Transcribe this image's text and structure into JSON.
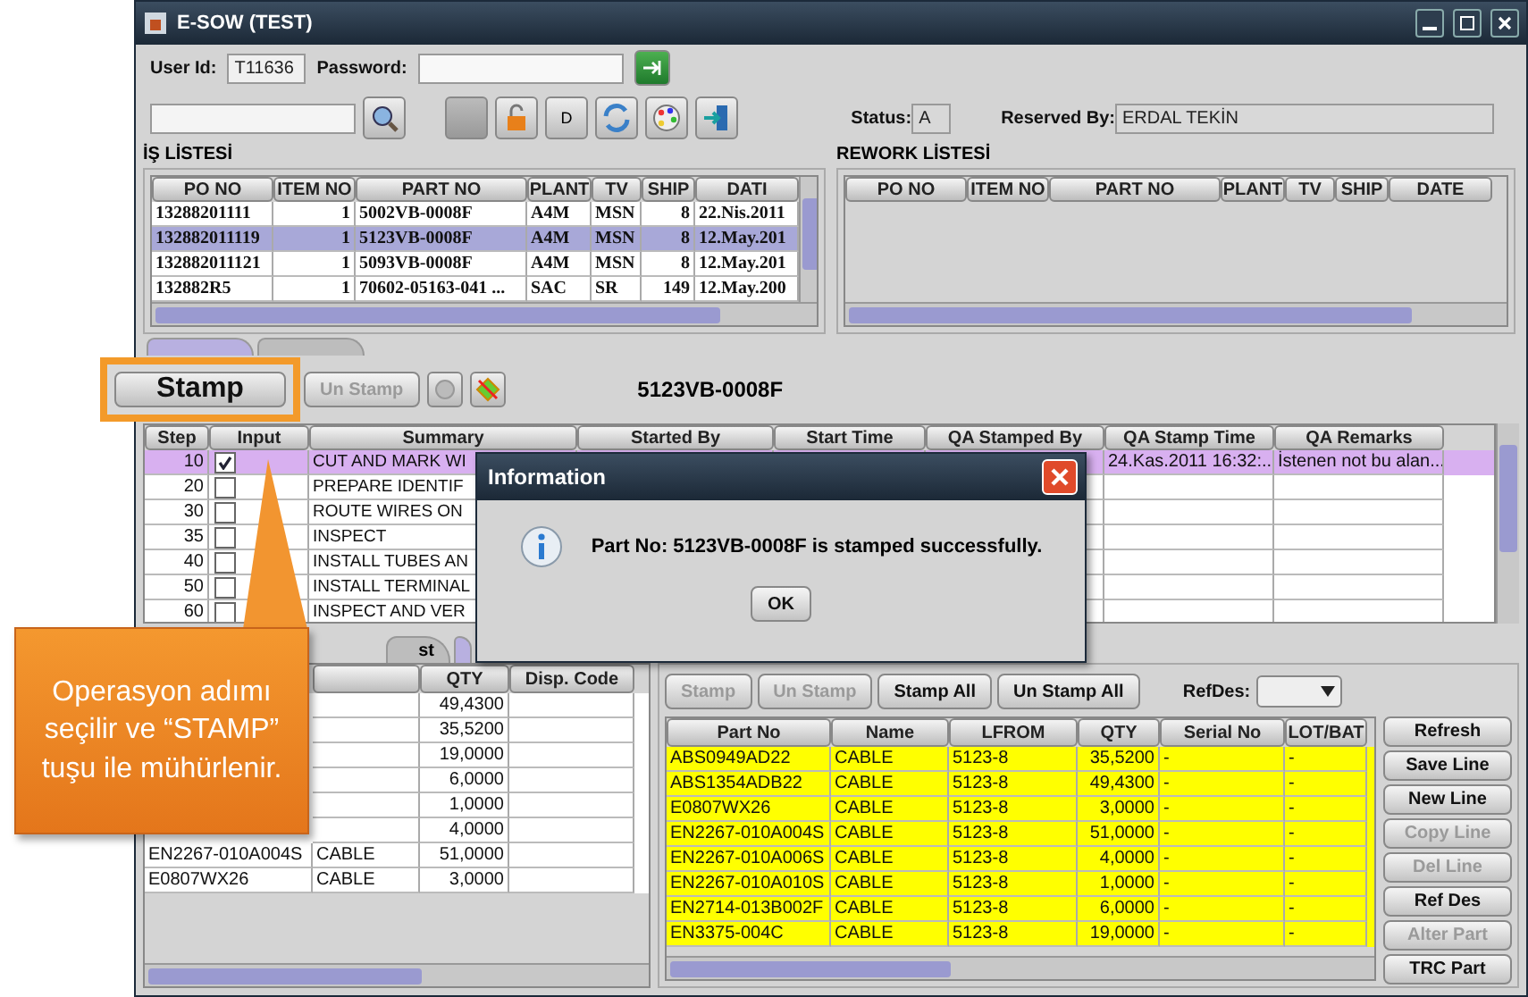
{
  "window": {
    "title": "E-SOW (TEST)"
  },
  "login": {
    "user_id_label": "User Id:",
    "user_id": "T11636",
    "password_label": "Password:"
  },
  "toolbar": {
    "d_button": "D",
    "status_label": "Status:",
    "status": "A",
    "reserved_label": "Reserved By:",
    "reserved_by": "ERDAL TEKİN"
  },
  "work_list": {
    "title": "İŞ LİSTESİ",
    "columns": [
      "PO NO",
      "ITEM NO",
      "PART NO",
      "PLANT",
      "TV",
      "SHIP",
      "DATI"
    ],
    "rows": [
      {
        "cells": [
          "13288201111",
          "1",
          "5002VB-0008F",
          "A4M",
          "MSN",
          "8",
          "22.Nis.2011"
        ],
        "selected": false
      },
      {
        "cells": [
          "132882011119",
          "1",
          "5123VB-0008F",
          "A4M",
          "MSN",
          "8",
          "12.May.201"
        ],
        "selected": true
      },
      {
        "cells": [
          "132882011121",
          "1",
          "5093VB-0008F",
          "A4M",
          "MSN",
          "8",
          "12.May.201"
        ],
        "selected": false
      },
      {
        "cells": [
          "132882R5",
          "1",
          "70602-05163-041     ...",
          "SAC",
          "SR",
          "149",
          "12.May.200"
        ],
        "selected": false
      }
    ]
  },
  "rework_list": {
    "title": "REWORK LİSTESİ",
    "columns": [
      "PO NO",
      "ITEM NO",
      "PART NO",
      "PLANT",
      "TV",
      "SHIP",
      "DATE"
    ]
  },
  "main_tabs": [
    {
      "selected": true
    },
    {
      "selected": false
    }
  ],
  "stamp_bar": {
    "unstamp": "Un Stamp",
    "part_no": "5123VB-0008F"
  },
  "steps": {
    "columns": [
      "Step",
      "Input",
      "Summary",
      "Started By",
      "Start Time",
      "QA Stamped By",
      "QA Stamp Time",
      "QA Remarks"
    ],
    "rows": [
      {
        "step": "10",
        "checked": true,
        "summary": "CUT AND MARK WI",
        "qa_stamp_time": "24.Kas.2011 16:32:...",
        "qa_remarks": "İstenen not bu alan...",
        "selected": true
      },
      {
        "step": "20",
        "checked": false,
        "summary": "PREPARE IDENTIF",
        "selected": false
      },
      {
        "step": "30",
        "checked": false,
        "summary": "ROUTE WIRES ON",
        "selected": false
      },
      {
        "step": "35",
        "checked": false,
        "summary": "INSPECT",
        "selected": false
      },
      {
        "step": "40",
        "checked": false,
        "summary": "INSTALL TUBES AN",
        "selected": false
      },
      {
        "step": "50",
        "checked": false,
        "summary": "INSTALL TERMINAL",
        "selected": false
      },
      {
        "step": "60",
        "checked": false,
        "summary": "INSPECT AND VER",
        "selected": false
      }
    ]
  },
  "materials": {
    "tabs": [
      {
        "label": "st",
        "selected": false
      },
      {
        "selected": true
      }
    ],
    "columns": [
      "QTY",
      "Disp. Code"
    ],
    "rows": [
      {
        "qty": "49,4300"
      },
      {
        "qty": "35,5200"
      },
      {
        "qty": "19,0000"
      },
      {
        "qty": "6,0000"
      },
      {
        "qty": "1,0000"
      },
      {
        "qty": "4,0000"
      },
      {
        "part_no": "EN2267-010A004S",
        "name": "CABLE",
        "qty": "51,0000"
      },
      {
        "part_no": "E0807WX26",
        "name": "CABLE",
        "qty": "3,0000"
      }
    ]
  },
  "parts": {
    "buttons": [
      {
        "label": "Stamp",
        "disabled": true
      },
      {
        "label": "Un Stamp",
        "disabled": true
      },
      {
        "label": "Stamp All",
        "disabled": false
      },
      {
        "label": "Un Stamp All",
        "disabled": false
      }
    ],
    "refdes_label": "RefDes:",
    "columns": [
      "Part No",
      "Name",
      "LFROM",
      "QTY",
      "Serial No",
      "LOT/BAT"
    ],
    "rows": [
      [
        "ABS0949AD22",
        "CABLE",
        "5123-8",
        "35,5200",
        "-",
        "-"
      ],
      [
        "ABS1354ADB22",
        "CABLE",
        "5123-8",
        "49,4300",
        "-",
        "-"
      ],
      [
        "E0807WX26",
        "CABLE",
        "5123-8",
        "3,0000",
        "-",
        "-"
      ],
      [
        "EN2267-010A004S",
        "CABLE",
        "5123-8",
        "51,0000",
        "-",
        "-"
      ],
      [
        "EN2267-010A006S",
        "CABLE",
        "5123-8",
        "4,0000",
        "-",
        "-"
      ],
      [
        "EN2267-010A010S",
        "CABLE",
        "5123-8",
        "1,0000",
        "-",
        "-"
      ],
      [
        "EN2714-013B002F",
        "CABLE",
        "5123-8",
        "6,0000",
        "-",
        "-"
      ],
      [
        "EN3375-004C",
        "CABLE",
        "5123-8",
        "19,0000",
        "-",
        "-"
      ]
    ],
    "side_buttons": [
      {
        "label": "Refresh",
        "disabled": false
      },
      {
        "label": "Save Line",
        "disabled": false
      },
      {
        "label": "New Line",
        "disabled": false
      },
      {
        "label": "Copy Line",
        "disabled": true
      },
      {
        "label": "Del Line",
        "disabled": true
      },
      {
        "label": "Ref Des",
        "disabled": false
      },
      {
        "label": "Alter Part",
        "disabled": true
      },
      {
        "label": "TRC Part",
        "disabled": false
      }
    ]
  },
  "dialog": {
    "title": "Information",
    "message": "Part No: 5123VB-0008F is stamped successfully.",
    "button": "OK"
  },
  "callout": {
    "text": "Operasyon adımı seçilir ve “STAMP” tuşu ile mühürlenir.",
    "button": "Stamp"
  }
}
